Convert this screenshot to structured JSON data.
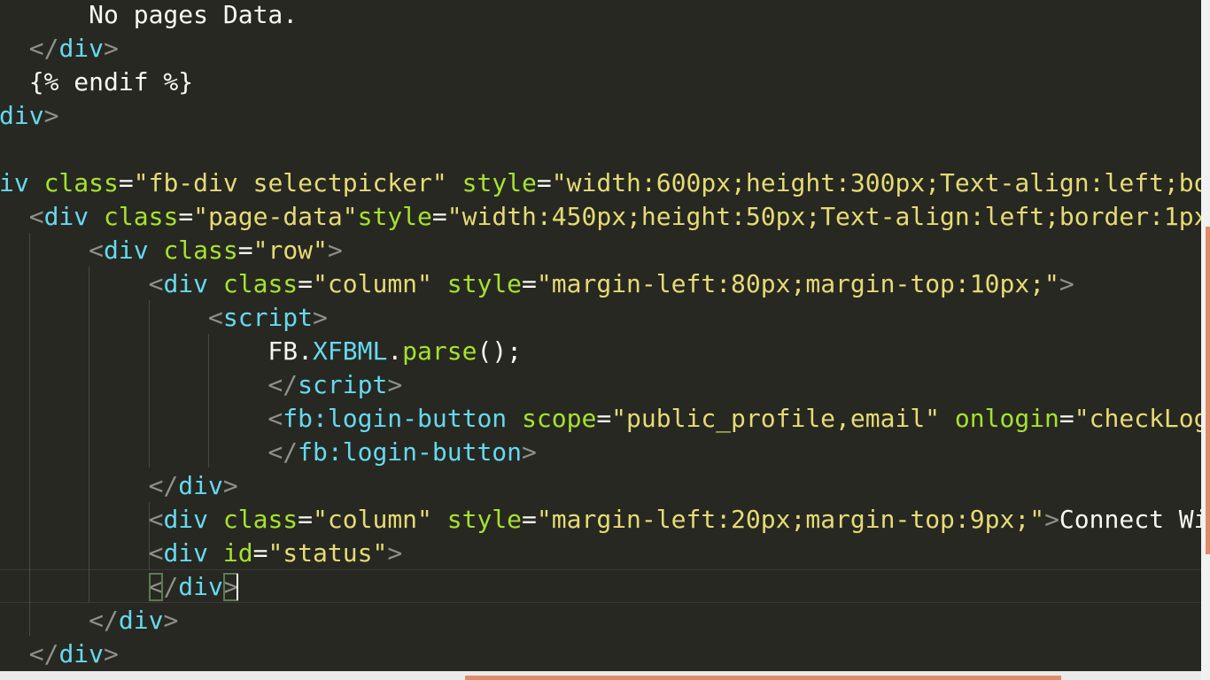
{
  "colors": {
    "background": "#272822",
    "plain": "#f8f8f2",
    "tag": "#66d9ef",
    "attr": "#a6e22e",
    "string": "#e6db74",
    "punct": "#8f908a",
    "property": "#e6db74",
    "function": "#a6e22e",
    "accent": "#e08c6a"
  },
  "lines": [
    [
      {
        "t": "      No pages Data.",
        "c": "plain"
      }
    ],
    [
      {
        "t": "  </",
        "c": "punct"
      },
      {
        "t": "div",
        "c": "tag"
      },
      {
        "t": ">",
        "c": "punct"
      }
    ],
    [
      {
        "t": "  {% endif %}",
        "c": "plain"
      }
    ],
    [
      {
        "t": "div",
        "c": "tag"
      },
      {
        "t": ">",
        "c": "punct"
      }
    ],
    [],
    [
      {
        "t": "iv ",
        "c": "tag"
      },
      {
        "t": "class",
        "c": "attr"
      },
      {
        "t": "=",
        "c": "plain"
      },
      {
        "t": "\"fb-div selectpicker\"",
        "c": "string"
      },
      {
        "t": " ",
        "c": "plain"
      },
      {
        "t": "style",
        "c": "attr"
      },
      {
        "t": "=",
        "c": "plain"
      },
      {
        "t": "\"width:600px;height:300px;Text-align:left;bo",
        "c": "string"
      }
    ],
    [
      {
        "t": "  <",
        "c": "punct"
      },
      {
        "t": "div ",
        "c": "tag"
      },
      {
        "t": "class",
        "c": "attr"
      },
      {
        "t": "=",
        "c": "plain"
      },
      {
        "t": "\"page-data\"",
        "c": "string"
      },
      {
        "t": "style",
        "c": "attr"
      },
      {
        "t": "=",
        "c": "plain"
      },
      {
        "t": "\"width:450px;height:50px;Text-align:left;border:1px",
        "c": "string"
      }
    ],
    [
      {
        "t": "      <",
        "c": "punct"
      },
      {
        "t": "div ",
        "c": "tag"
      },
      {
        "t": "class",
        "c": "attr"
      },
      {
        "t": "=",
        "c": "plain"
      },
      {
        "t": "\"row\"",
        "c": "string"
      },
      {
        "t": ">",
        "c": "punct"
      }
    ],
    [
      {
        "t": "          <",
        "c": "punct"
      },
      {
        "t": "div ",
        "c": "tag"
      },
      {
        "t": "class",
        "c": "attr"
      },
      {
        "t": "=",
        "c": "plain"
      },
      {
        "t": "\"column\"",
        "c": "string"
      },
      {
        "t": " ",
        "c": "plain"
      },
      {
        "t": "style",
        "c": "attr"
      },
      {
        "t": "=",
        "c": "plain"
      },
      {
        "t": "\"margin-left:80px;margin-top:10px;\"",
        "c": "string"
      },
      {
        "t": ">",
        "c": "punct"
      }
    ],
    [
      {
        "t": "              <",
        "c": "punct"
      },
      {
        "t": "script",
        "c": "tag"
      },
      {
        "t": ">",
        "c": "punct"
      }
    ],
    [
      {
        "t": "                  FB.",
        "c": "plain"
      },
      {
        "t": "XFBML",
        "c": "tag"
      },
      {
        "t": ".",
        "c": "plain"
      },
      {
        "t": "parse",
        "c": "function"
      },
      {
        "t": "();",
        "c": "plain"
      }
    ],
    [
      {
        "t": "                  </",
        "c": "punct"
      },
      {
        "t": "script",
        "c": "tag"
      },
      {
        "t": ">",
        "c": "punct"
      }
    ],
    [
      {
        "t": "                  <",
        "c": "punct"
      },
      {
        "t": "fb:login-button ",
        "c": "tag"
      },
      {
        "t": "scope",
        "c": "attr"
      },
      {
        "t": "=",
        "c": "plain"
      },
      {
        "t": "\"public_profile,email\"",
        "c": "string"
      },
      {
        "t": " ",
        "c": "plain"
      },
      {
        "t": "onlogin",
        "c": "attr"
      },
      {
        "t": "=",
        "c": "plain"
      },
      {
        "t": "\"checkLog",
        "c": "string"
      }
    ],
    [
      {
        "t": "                  </",
        "c": "punct"
      },
      {
        "t": "fb:login-button",
        "c": "tag"
      },
      {
        "t": ">",
        "c": "punct"
      }
    ],
    [
      {
        "t": "          </",
        "c": "punct"
      },
      {
        "t": "div",
        "c": "tag"
      },
      {
        "t": ">",
        "c": "punct"
      }
    ],
    [
      {
        "t": "          <",
        "c": "punct"
      },
      {
        "t": "div ",
        "c": "tag"
      },
      {
        "t": "class",
        "c": "attr"
      },
      {
        "t": "=",
        "c": "plain"
      },
      {
        "t": "\"column\"",
        "c": "string"
      },
      {
        "t": " ",
        "c": "plain"
      },
      {
        "t": "style",
        "c": "attr"
      },
      {
        "t": "=",
        "c": "plain"
      },
      {
        "t": "\"margin-left:20px;margin-top:9px;\"",
        "c": "string"
      },
      {
        "t": ">",
        "c": "punct"
      },
      {
        "t": "Connect Wi",
        "c": "plain"
      }
    ],
    [
      {
        "t": "          <",
        "c": "punct"
      },
      {
        "t": "div ",
        "c": "tag"
      },
      {
        "t": "id",
        "c": "attr"
      },
      {
        "t": "=",
        "c": "plain"
      },
      {
        "t": "\"status\"",
        "c": "string"
      },
      {
        "t": ">",
        "c": "punct"
      }
    ],
    [
      {
        "t": "          ",
        "c": "plain"
      },
      {
        "t": "<",
        "c": "punct",
        "m": true
      },
      {
        "t": "/",
        "c": "punct"
      },
      {
        "t": "div",
        "c": "tag"
      },
      {
        "t": ">",
        "c": "punct",
        "m": true
      }
    ],
    [
      {
        "t": "      </",
        "c": "punct"
      },
      {
        "t": "div",
        "c": "tag"
      },
      {
        "t": ">",
        "c": "punct"
      }
    ],
    [
      {
        "t": "  </",
        "c": "punct"
      },
      {
        "t": "div",
        "c": "tag"
      },
      {
        "t": ">",
        "c": "punct"
      }
    ]
  ]
}
